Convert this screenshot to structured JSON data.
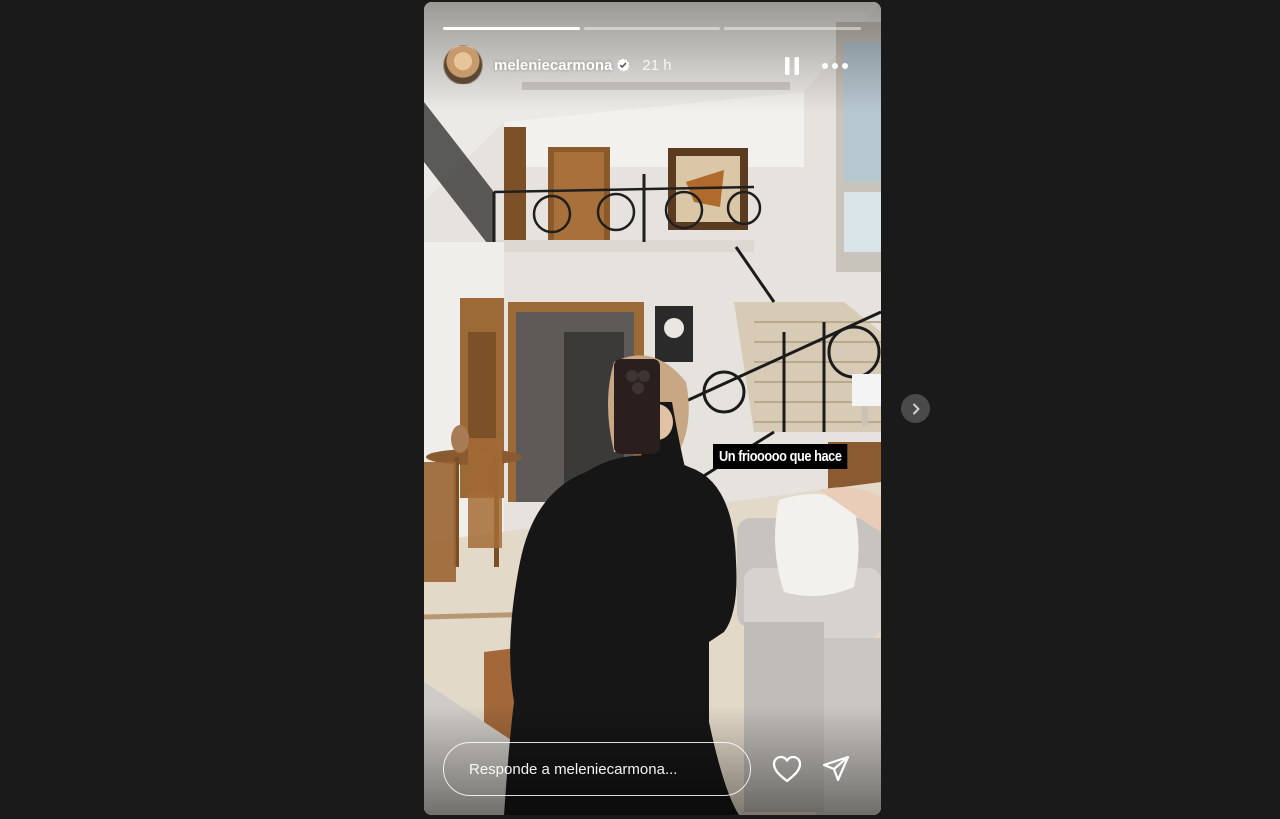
{
  "story": {
    "progress": [
      1.0,
      0.0,
      0.0
    ],
    "progress_current": 0.15,
    "username": "meleniecarmona",
    "timestamp": "21 h",
    "caption": "Un friooooo que hace",
    "reply_placeholder": "Responde a meleniecarmona..."
  },
  "icons": {
    "pause": "pause-icon",
    "more": "more-horizontal-icon",
    "like": "heart-icon",
    "share": "send-icon",
    "next": "chevron-right-icon",
    "verified": "verified-badge-icon"
  },
  "colors": {
    "background": "#1a1a1a",
    "text": "#ffffff",
    "caption_bg": "#000000",
    "next_button": "#4a4a4a"
  }
}
